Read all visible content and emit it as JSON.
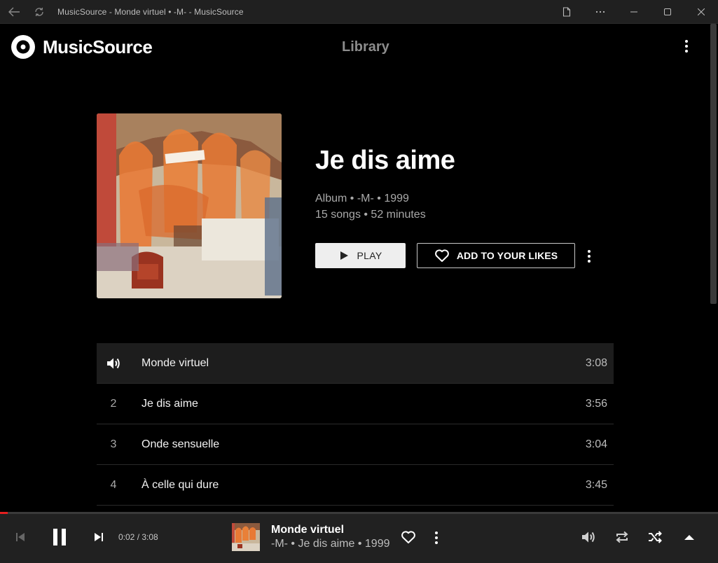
{
  "window": {
    "title": "MusicSource - Monde virtuel • -M- - MusicSource"
  },
  "app": {
    "brand": "MusicSource",
    "nav_library": "Library"
  },
  "album": {
    "title": "Je dis aime",
    "meta_line1": "Album • -M- • 1999",
    "meta_line2": "15 songs • 52 minutes",
    "play_label": "PLAY",
    "likes_label": "ADD TO YOUR LIKES"
  },
  "tracks": [
    {
      "number": "1",
      "title": "Monde virtuel",
      "duration": "3:08",
      "playing": true
    },
    {
      "number": "2",
      "title": "Je dis aime",
      "duration": "3:56",
      "playing": false
    },
    {
      "number": "3",
      "title": "Onde sensuelle",
      "duration": "3:04",
      "playing": false
    },
    {
      "number": "4",
      "title": "À celle qui dure",
      "duration": "3:45",
      "playing": false
    }
  ],
  "player": {
    "time": "0:02 / 3:08",
    "progress_fraction": 0.011,
    "now_playing_title": "Monde virtuel",
    "now_playing_sub": "-M- • Je dis aime • 1999"
  },
  "colors": {
    "accent": "#e41f1f",
    "background": "#000000",
    "player_bar": "#212121"
  },
  "icons": {
    "back": "arrow-left-icon",
    "refresh": "refresh-icon",
    "page": "page-icon",
    "more": "more-horizontal-icon",
    "minimize": "minimize-icon",
    "maximize": "maximize-icon",
    "close": "close-icon",
    "playing": "volume-icon"
  }
}
